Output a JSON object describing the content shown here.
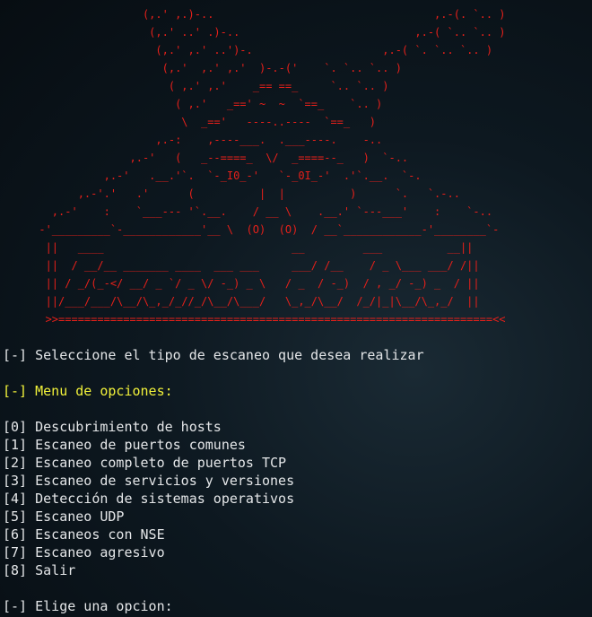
{
  "banner_art": "                      (,.' ,.)-..                                  ,.-(. `.. )\n                       (,.' ..' .)-..                           ,.-( `.. `.. )\n                        (,.' ,.' ..')-.                    ,.-( `. `.. `.. )\n                         (,.'  ,.' ,.'  )-.-('    `. `.. `.. )\n                          ( ,.' ,.'    _== ==_     `.. `.. )\n                           ( ,.'   _==' ~  ~  `==_    `.. )\n                            \\  _=='   ----..----  `==_   )\n                        ,.-:    ,----___.  .___----.    -..\n                    ,.-'   (   _--====_  \\/  _====--_   )  `-..\n                ,.-'   .__.'`.  `-_I0_-'   `-_0I_-'  .'`.__.  `-.\n            ,.-'.'   .'      (          |  |          )      `.   `.-..\n        ,.-'    :    `___--- '`.__.    / __ \\    .__.' `---___'    :    `-..\n      -'_________`-____________'__ \\  (O)  (O)  / __`____________-'________`-\n       ||   ____                             __         ___          __||\n       ||  / __/__ _______ ____  ___ ___     ___/ /__    / _ \\___ ___/ /||\n       || / _/(_-</ __/ _ `/ _ \\/ -_) _ \\   / _  / -_)  / , _/ -_) _  / ||\n       ||/___/___/\\__/\\_,_/_//_/\\__/\\___/   \\_,_/\\__/  /_/|_|\\__/\\_,_/  ||\n       >>===================================================================<<",
  "prompt_marker": "[-]",
  "scan_type_prompt": "[-] Seleccione el tipo de escaneo que desea realizar",
  "menu_title": "[-] Menu de opciones:",
  "menu_options": [
    "[0] Descubrimiento de hosts",
    "[1] Escaneo de puertos comunes",
    "[2] Escaneo completo de puertos TCP",
    "[3] Escaneo de servicios y versiones",
    "[4] Detección de sistemas operativos",
    "[5] Escaneo UDP",
    "[6] Escaneos con NSE",
    "[7] Escaneo agresivo",
    "[8] Salir"
  ],
  "choose_prompt": "[-] Elige una opcion:",
  "colors": {
    "banner": "#e6201a",
    "text": "#e4e6e8",
    "menu_title": "#f2f23a",
    "background": "#0d1820"
  }
}
